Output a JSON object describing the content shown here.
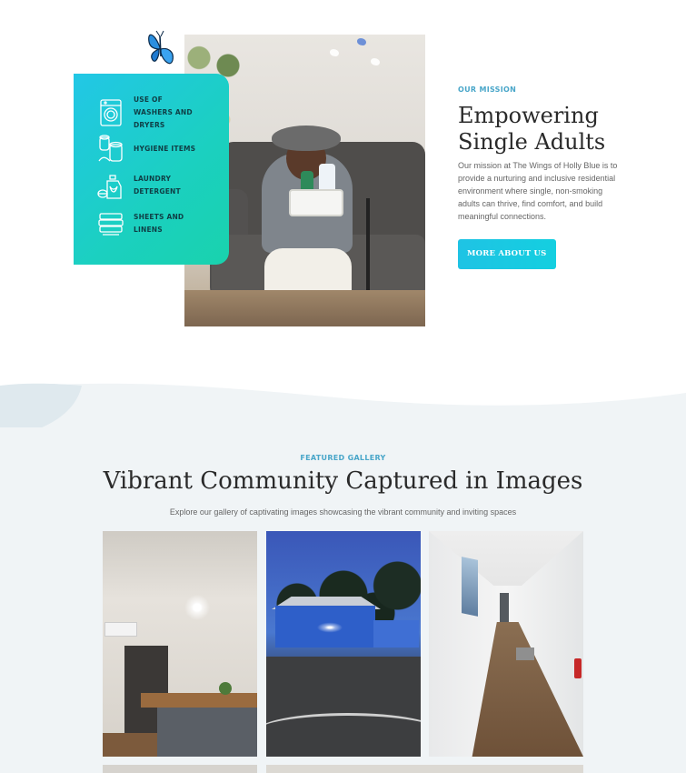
{
  "mission": {
    "eyebrow": "OUR MISSION",
    "title_line1": "Empowering",
    "title_line2": "Single Adults",
    "description": "Our mission at The Wings of Holly Blue is to provide a nurturing and inclusive residential environment where single, non-smoking adults can thrive, find comfort, and build meaningful connections.",
    "button_label": "MORE ABOUT US",
    "amenities": [
      {
        "label": "USE OF WASHERS AND DRYERS",
        "icon": "washing-machine-icon"
      },
      {
        "label": "HYGIENE ITEMS",
        "icon": "toilet-paper-icon"
      },
      {
        "label": "LAUNDRY DETERGENT",
        "icon": "detergent-bottle-icon"
      },
      {
        "label": "SHEETS AND LINENS",
        "icon": "folded-linens-icon"
      }
    ]
  },
  "gallery": {
    "eyebrow": "FEATURED GALLERY",
    "title": "Vibrant Community Captured in Images",
    "subtitle": "Explore our gallery of captivating images showcasing the vibrant community and inviting spaces",
    "images": [
      {
        "subject": "room-with-kitchenette"
      },
      {
        "subject": "building-at-dusk",
        "sign": "The Wings of Holly Blue"
      },
      {
        "subject": "hallway"
      }
    ]
  },
  "colors": {
    "accent": "#22c7e6",
    "accent_green": "#19d2ad",
    "eyebrow": "#49a6c9",
    "heading": "#2a2a2a",
    "gallery_bg": "#f0f4f6"
  }
}
